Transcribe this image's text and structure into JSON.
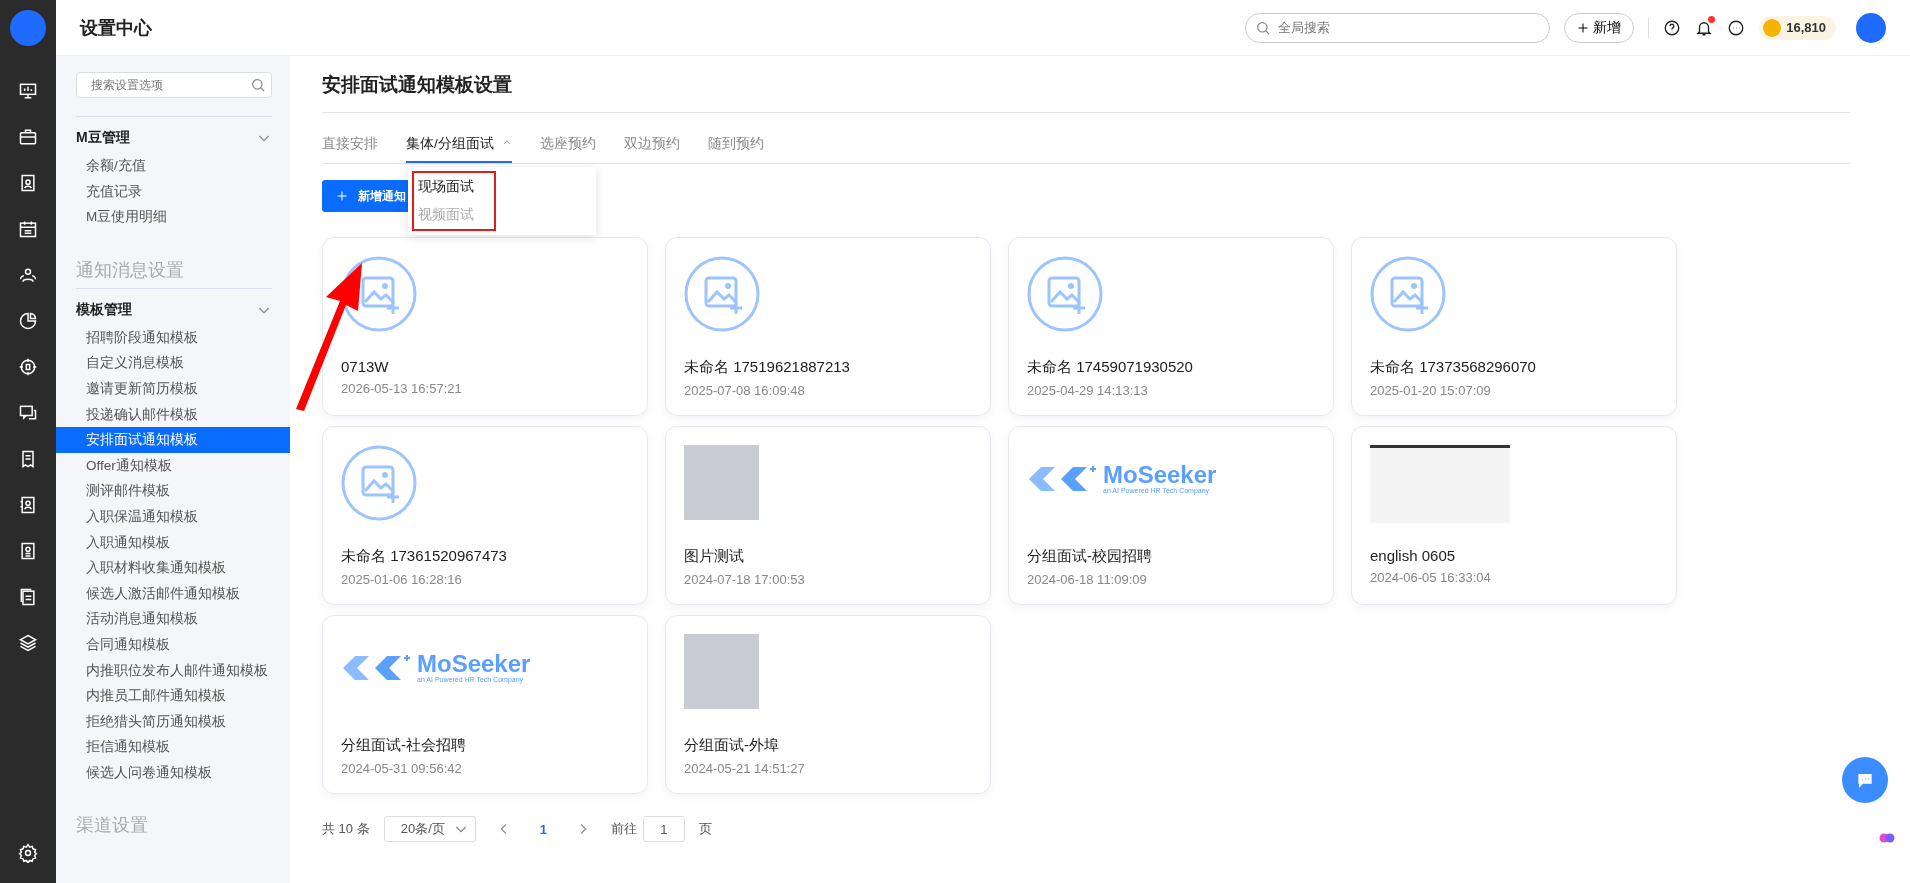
{
  "app_title": "设置中心",
  "header": {
    "search_placeholder": "全局搜索",
    "new_button": "新增",
    "notification_unread": true,
    "coins": "16,810"
  },
  "sidebar": {
    "search_placeholder": "搜索设置选项",
    "sections": [
      {
        "kind": "group",
        "title": "M豆管理",
        "expanded": true,
        "items": [
          {
            "label": "余额/充值",
            "selected": false
          },
          {
            "label": "充值记录",
            "selected": false
          },
          {
            "label": "M豆使用明细",
            "selected": false
          }
        ]
      },
      {
        "kind": "heading",
        "title": "通知消息设置"
      },
      {
        "kind": "group",
        "title": "模板管理",
        "expanded": true,
        "items": [
          {
            "label": "招聘阶段通知模板",
            "selected": false
          },
          {
            "label": "自定义消息模板",
            "selected": false
          },
          {
            "label": "邀请更新简历模板",
            "selected": false
          },
          {
            "label": "投递确认邮件模板",
            "selected": false
          },
          {
            "label": "安排面试通知模板",
            "selected": true
          },
          {
            "label": "Offer通知模板",
            "selected": false
          },
          {
            "label": "测评邮件模板",
            "selected": false
          },
          {
            "label": "入职保温通知模板",
            "selected": false
          },
          {
            "label": "入职通知模板",
            "selected": false
          },
          {
            "label": "入职材料收集通知模板",
            "selected": false
          },
          {
            "label": "候选人激活邮件通知模板",
            "selected": false
          },
          {
            "label": "活动消息通知模板",
            "selected": false
          },
          {
            "label": "合同通知模板",
            "selected": false
          },
          {
            "label": "内推职位发布人邮件通知模板",
            "selected": false
          },
          {
            "label": "内推员工邮件通知模板",
            "selected": false
          },
          {
            "label": "拒绝猎头简历通知模板",
            "selected": false
          },
          {
            "label": "拒信通知模板",
            "selected": false
          },
          {
            "label": "候选人问卷通知模板",
            "selected": false
          }
        ]
      },
      {
        "kind": "heading",
        "title": "渠道设置"
      }
    ]
  },
  "page": {
    "title": "安排面试通知模板设置",
    "tabs": [
      {
        "label": "直接安排",
        "selected": false
      },
      {
        "label": "集体/分组面试",
        "selected": true,
        "expanded": true
      },
      {
        "label": "选座预约",
        "selected": false
      },
      {
        "label": "双边预约",
        "selected": false
      },
      {
        "label": "随到预约",
        "selected": false
      }
    ],
    "dropdown": [
      {
        "label": "现场面试",
        "selected": true
      },
      {
        "label": "视频面试",
        "selected": false
      }
    ],
    "add_button": "新增通知",
    "cards": [
      {
        "kind": "placeholder",
        "name": "0713W",
        "date": "2026-05-13 16:57:21"
      },
      {
        "kind": "placeholder",
        "name": "未命名 17519621887213",
        "date": "2025-07-08 16:09:48"
      },
      {
        "kind": "placeholder",
        "name": "未命名 17459071930520",
        "date": "2025-04-29 14:13:13"
      },
      {
        "kind": "placeholder",
        "name": "未命名 17373568296070",
        "date": "2025-01-20 15:07:09"
      },
      {
        "kind": "placeholder",
        "name": "未命名 17361520967473",
        "date": "2025-01-06 16:28:16"
      },
      {
        "kind": "photo",
        "name": "图片测试",
        "date": "2024-07-18 17:00:53"
      },
      {
        "kind": "logo",
        "logo_text": "MoSeeker",
        "logo_tagline": "an AI Powered HR Tech Company",
        "name": "分组面试-校园招聘",
        "date": "2024-06-18 11:09:09"
      },
      {
        "kind": "landscape",
        "name": "english 0605",
        "date": "2024-06-05 16:33:04"
      },
      {
        "kind": "logo",
        "logo_text": "MoSeeker",
        "logo_tagline": "an AI Powered HR Tech Company",
        "name": "分组面试-社会招聘",
        "date": "2024-05-31 09:56:42"
      },
      {
        "kind": "photo",
        "name": "分组面试-外埠",
        "date": "2024-05-21 14:51:27"
      }
    ],
    "pagination": {
      "total": "共 10 条",
      "page_size": "20条/页",
      "pages": [
        {
          "label": "1",
          "selected": true
        }
      ],
      "goto_label": "前往",
      "goto_value": "1",
      "goto_suffix": "页"
    }
  }
}
